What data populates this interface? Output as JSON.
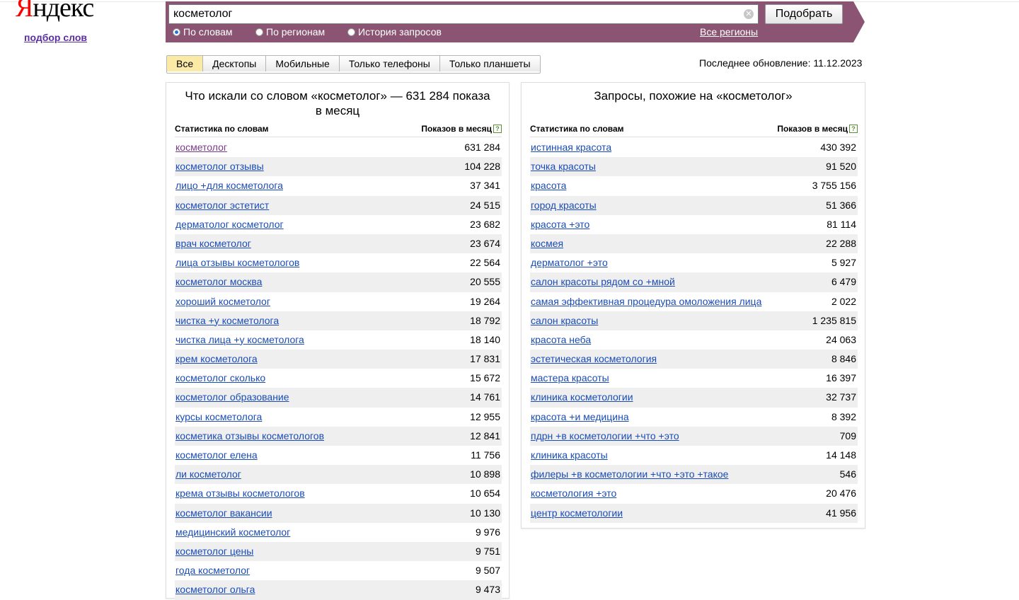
{
  "logo": {
    "first_letter": "Я",
    "rest": "ндекс",
    "subtitle": "подбор слов"
  },
  "search": {
    "value": "косметолог",
    "clear_glyph": "✕",
    "submit_label": "Подобрать",
    "modes": [
      {
        "label": "По словам",
        "checked": true
      },
      {
        "label": "По регионам",
        "checked": false
      },
      {
        "label": "История запросов",
        "checked": false
      }
    ],
    "regions_label": "Все регионы"
  },
  "tabs": [
    "Все",
    "Десктопы",
    "Мобильные",
    "Только телефоны",
    "Только планшеты"
  ],
  "last_update": "Последнее обновление: 11.12.2023",
  "left_panel": {
    "title": "Что искали со словом «косметолог» — 631 284 показа в месяц",
    "col_word": "Статистика по словам",
    "col_count": "Показов в месяц",
    "help_glyph": "?",
    "rows": [
      {
        "word": "косметолог",
        "count": "631 284"
      },
      {
        "word": "косметолог отзывы",
        "count": "104 228"
      },
      {
        "word": "лицо +для косметолога",
        "count": "37 341"
      },
      {
        "word": "косметолог эстетист",
        "count": "24 515"
      },
      {
        "word": "дерматолог косметолог",
        "count": "23 682"
      },
      {
        "word": "врач косметолог",
        "count": "23 674"
      },
      {
        "word": "лица отзывы косметологов",
        "count": "22 564"
      },
      {
        "word": "косметолог москва",
        "count": "20 555"
      },
      {
        "word": "хороший косметолог",
        "count": "19 264"
      },
      {
        "word": "чистка +у косметолога",
        "count": "18 792"
      },
      {
        "word": "чистка лица +у косметолога",
        "count": "18 140"
      },
      {
        "word": "крем косметолога",
        "count": "17 831"
      },
      {
        "word": "косметолог сколько",
        "count": "15 672"
      },
      {
        "word": "косметолог образование",
        "count": "14 761"
      },
      {
        "word": "курсы косметолога",
        "count": "12 955"
      },
      {
        "word": "косметика отзывы косметологов",
        "count": "12 841"
      },
      {
        "word": "косметолог елена",
        "count": "11 756"
      },
      {
        "word": "ли косметолог",
        "count": "10 898"
      },
      {
        "word": "крема отзывы косметологов",
        "count": "10 654"
      },
      {
        "word": "косметолог вакансии",
        "count": "10 130"
      },
      {
        "word": "медицинский косметолог",
        "count": "9 976"
      },
      {
        "word": "косметолог цены",
        "count": "9 751"
      },
      {
        "word": "года косметолог",
        "count": "9 507"
      },
      {
        "word": "косметолог ольга",
        "count": "9 473"
      }
    ]
  },
  "right_panel": {
    "title": "Запросы, похожие на «косметолог»",
    "col_word": "Статистика по словам",
    "col_count": "Показов в месяц",
    "help_glyph": "?",
    "rows": [
      {
        "word": "истинная красота",
        "count": "430 392"
      },
      {
        "word": "точка красоты",
        "count": "91 520"
      },
      {
        "word": "красота",
        "count": "3 755 156"
      },
      {
        "word": "город красоты",
        "count": "51 366"
      },
      {
        "word": "красота +это",
        "count": "81 114"
      },
      {
        "word": "космея",
        "count": "22 288"
      },
      {
        "word": "дерматолог +это",
        "count": "5 927"
      },
      {
        "word": "салон красоты рядом со +мной",
        "count": "6 479"
      },
      {
        "word": "самая эффективная процедура омоложения лица",
        "count": "2 022"
      },
      {
        "word": "салон красоты",
        "count": "1 235 815"
      },
      {
        "word": "красота неба",
        "count": "24 063"
      },
      {
        "word": "эстетическая косметология",
        "count": "8 846"
      },
      {
        "word": "мастера красоты",
        "count": "16 397"
      },
      {
        "word": "клиника косметологии",
        "count": "32 737"
      },
      {
        "word": "красота +и медицина",
        "count": "8 392"
      },
      {
        "word": "пдрн +в косметологии +что +это",
        "count": "709"
      },
      {
        "word": "клиника красоты",
        "count": "14 148"
      },
      {
        "word": "филеры +в косметологии +что +это +такое",
        "count": "546"
      },
      {
        "word": "косметология +это",
        "count": "20 476"
      },
      {
        "word": "центр косметологии",
        "count": "41 956"
      }
    ]
  }
}
